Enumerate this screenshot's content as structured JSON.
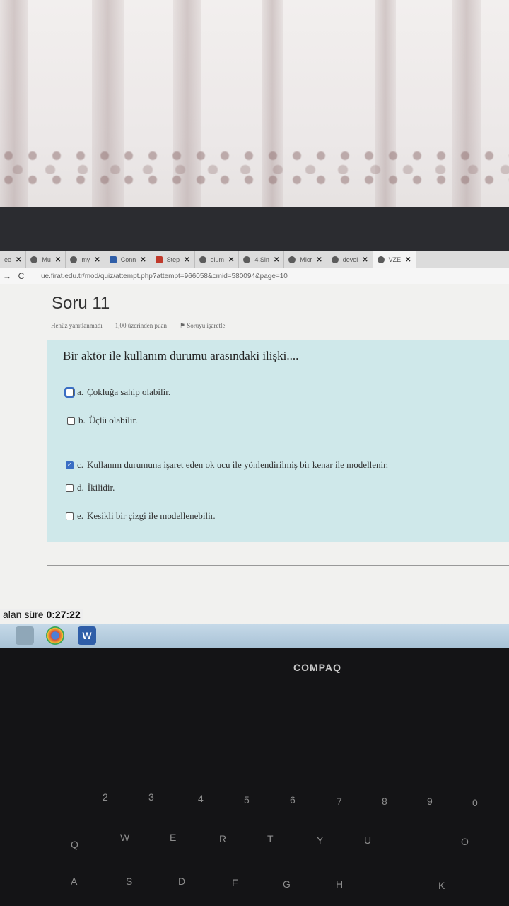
{
  "tabs": [
    {
      "label": "ee"
    },
    {
      "label": "Mu"
    },
    {
      "label": "my"
    },
    {
      "label": "Conn"
    },
    {
      "label": "Step"
    },
    {
      "label": "olum"
    },
    {
      "label": "4.Sin"
    },
    {
      "label": "Micr"
    },
    {
      "label": "devel"
    },
    {
      "label": "VZE"
    }
  ],
  "address": {
    "url": "ue.firat.edu.tr/mod/quiz/attempt.php?attempt=966058&cmid=580094&page=10"
  },
  "page": {
    "title": "Soru 11",
    "status": "Henüz yanıtlanmadı",
    "points": "1,00 üzerinden puan",
    "flag": "Soruyu işaretle"
  },
  "question": {
    "text": "Bir aktör ile kullanım durumu arasındaki ilişki....",
    "options": [
      {
        "letter": "a.",
        "text": "Çokluğa sahip olabilir.",
        "checked": false
      },
      {
        "letter": "b.",
        "text": "Üçlü olabilir.",
        "checked": false
      },
      {
        "letter": "c.",
        "text": "Kullanım durumuna işaret eden ok ucu ile yönlendirilmiş bir kenar ile modellenir.",
        "checked": true
      },
      {
        "letter": "d.",
        "text": "İkilidir.",
        "checked": false
      },
      {
        "letter": "e.",
        "text": "Kesikli bir çizgi ile modellenebilir.",
        "checked": false
      }
    ]
  },
  "timer": {
    "label": "alan süre",
    "value": "0:27:22"
  },
  "brand": "COMPAQ"
}
